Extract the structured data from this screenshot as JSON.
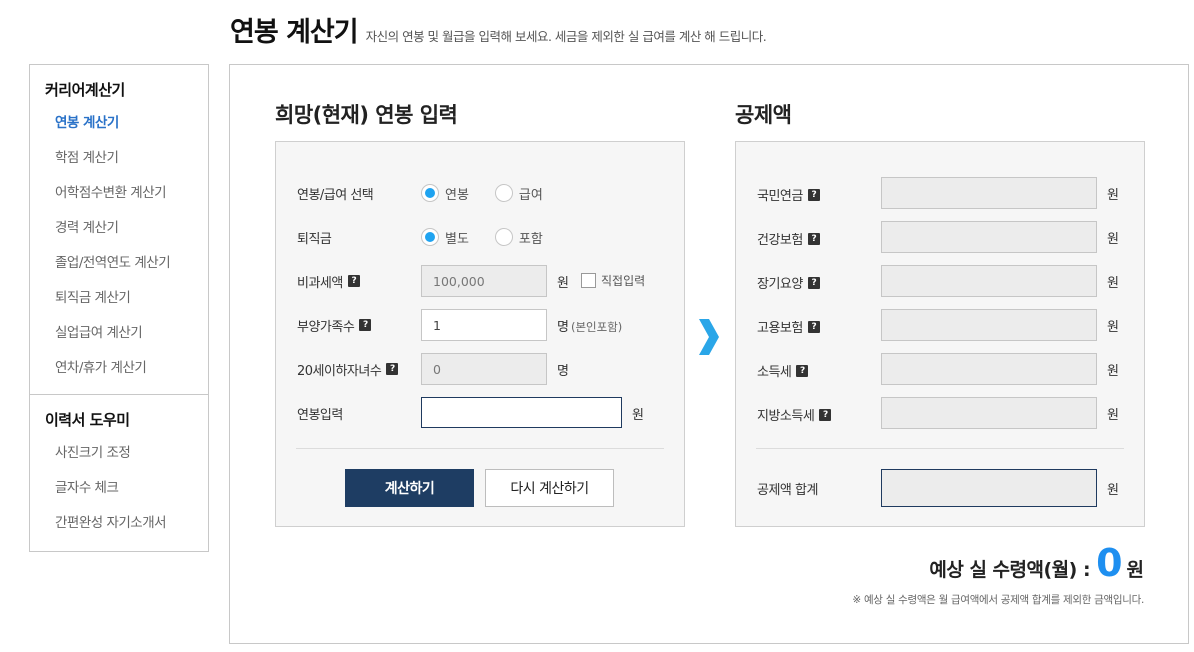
{
  "page": {
    "title": "연봉 계산기",
    "subtitle": "자신의 연봉 및 월급을 입력해 보세요. 세금을 제외한 실 급여를 계산 해 드립니다."
  },
  "sidebar": {
    "sections": [
      {
        "heading": "커리어계산기",
        "items": [
          "연봉 계산기",
          "학점 계산기",
          "어학점수변환 계산기",
          "경력 계산기",
          "졸업/전역연도 계산기",
          "퇴직금 계산기",
          "실업급여 계산기",
          "연차/휴가 계산기"
        ]
      },
      {
        "heading": "이력서 도우미",
        "items": [
          "사진크기 조정",
          "글자수 체크",
          "간편완성 자기소개서"
        ]
      }
    ],
    "active_item": "연봉 계산기"
  },
  "input_panel": {
    "title": "희망(현재) 연봉 입력",
    "salary_type": {
      "label": "연봉/급여 선택",
      "options": [
        "연봉",
        "급여"
      ],
      "selected": "연봉"
    },
    "severance": {
      "label": "퇴직금",
      "options": [
        "별도",
        "포함"
      ],
      "selected": "별도"
    },
    "nontaxable": {
      "label": "비과세액",
      "value": "100,000",
      "unit": "원",
      "checkbox_label": "직접입력"
    },
    "dependents": {
      "label": "부양가족수",
      "value": "1",
      "unit": "명",
      "unit_note": "(본인포함)"
    },
    "children": {
      "label": "20세이하자녀수",
      "value": "0",
      "unit": "명"
    },
    "salary": {
      "label": "연봉입력",
      "value": "",
      "unit": "원"
    },
    "calc_button": "계산하기",
    "reset_button": "다시 계산하기"
  },
  "deduction_panel": {
    "title": "공제액",
    "items": [
      {
        "label": "국민연금",
        "value": "",
        "unit": "원"
      },
      {
        "label": "건강보험",
        "value": "",
        "unit": "원"
      },
      {
        "label": "장기요양",
        "value": "",
        "unit": "원"
      },
      {
        "label": "고용보험",
        "value": "",
        "unit": "원"
      },
      {
        "label": "소득세",
        "value": "",
        "unit": "원"
      },
      {
        "label": "지방소득세",
        "value": "",
        "unit": "원"
      }
    ],
    "total": {
      "label": "공제액 합계",
      "value": "",
      "unit": "원"
    }
  },
  "result": {
    "label": "예상 실 수령액(월) :",
    "value": "0",
    "unit": "원",
    "note": "※ 예상 실 수령액은 월 급여액에서 공제액 합계를 제외한 금액입니다."
  },
  "colors": {
    "accent": "#1e8ff0",
    "primary_button": "#1e3d63",
    "radio_checked": "#1fa3f0",
    "active_link": "#2a72c8"
  }
}
